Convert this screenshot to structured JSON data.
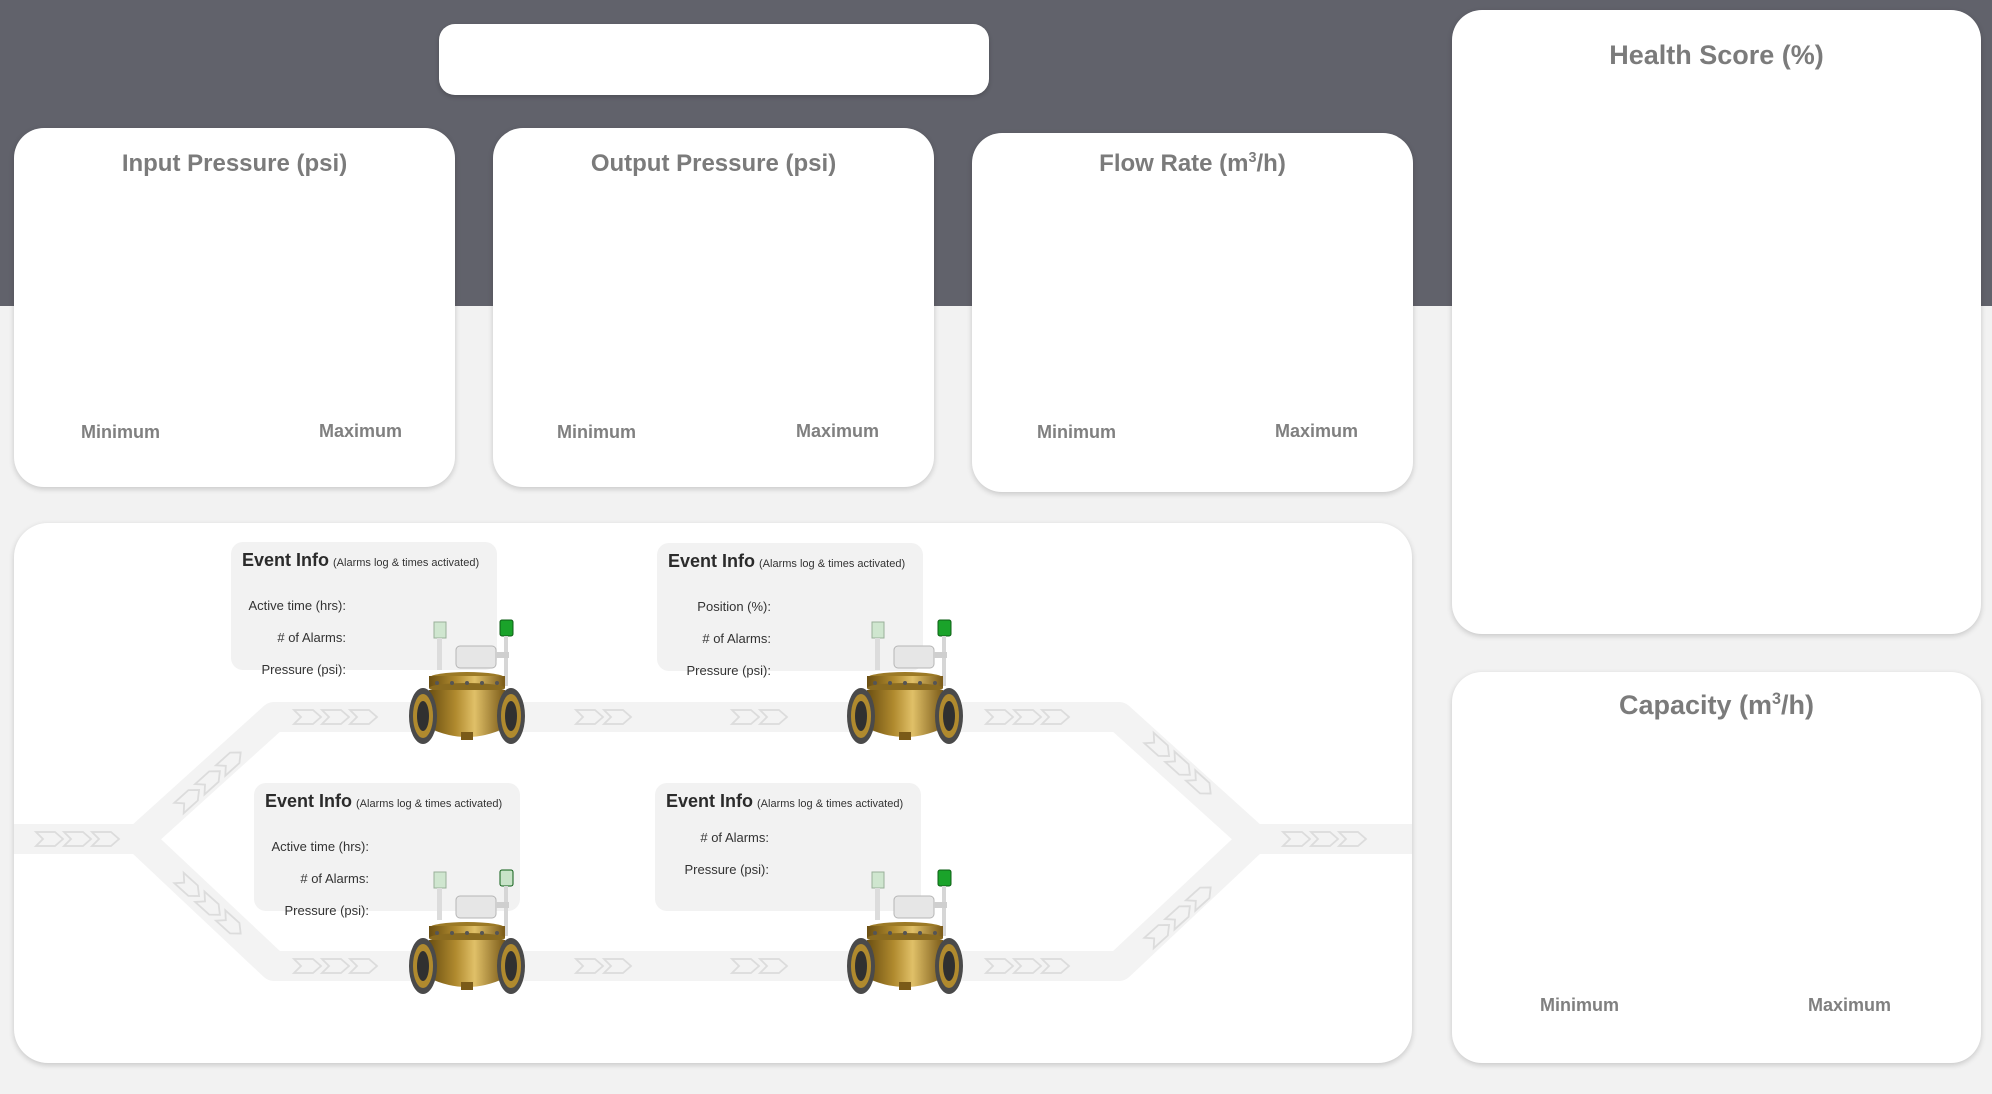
{
  "header": {
    "title_box_text": ""
  },
  "gauges": [
    {
      "title": "Input Pressure (psi)",
      "min_label": "Minimum",
      "max_label": "Maximum"
    },
    {
      "title": "Output Pressure (psi)",
      "min_label": "Minimum",
      "max_label": "Maximum"
    },
    {
      "title_prefix": "Flow Rate (m",
      "title_sup": "3",
      "title_suffix": "/h)",
      "min_label": "Minimum",
      "max_label": "Maximum"
    }
  ],
  "health": {
    "title": "Health Score (%)"
  },
  "capacity": {
    "title_prefix": "Capacity (m",
    "title_sup": "3",
    "title_suffix": "/h)",
    "min_label": "Minimum",
    "max_label": "Maximum"
  },
  "events": [
    {
      "title": "Event Info",
      "subtitle": "(Alarms log & times activated)",
      "labels": [
        "Active time (hrs):",
        "# of Alarms:",
        "Pressure (psi):"
      ]
    },
    {
      "title": "Event Info",
      "subtitle": "(Alarms log & times activated)",
      "labels": [
        "Position (%):",
        "# of Alarms:",
        "Pressure (psi):"
      ]
    },
    {
      "title": "Event Info",
      "subtitle": "(Alarms log & times activated)",
      "labels": [
        "Active time (hrs):",
        "# of Alarms:",
        "Pressure (psi):"
      ]
    },
    {
      "title": "Event Info",
      "subtitle": "(Alarms log & times activated)",
      "labels": [
        "# of Alarms:",
        "Pressure (psi):"
      ]
    }
  ],
  "valves": [
    {
      "name": "valve-top-left",
      "indicator": "green"
    },
    {
      "name": "valve-top-right",
      "indicator": "green"
    },
    {
      "name": "valve-bottom-left",
      "indicator": "off"
    },
    {
      "name": "valve-bottom-right",
      "indicator": "green"
    }
  ],
  "colors": {
    "band": "#61626b",
    "indicator_green": "#1aa32a",
    "indicator_off": "#c8e3c8",
    "brass": "#b08a2e"
  }
}
